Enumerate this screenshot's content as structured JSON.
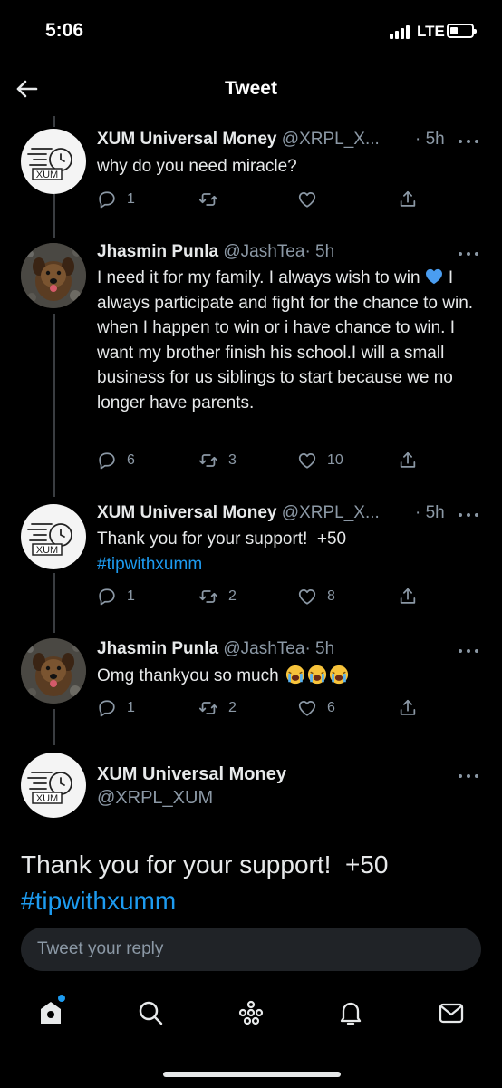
{
  "status": {
    "time": "5:06",
    "network": "LTE"
  },
  "header": {
    "title": "Tweet",
    "back_icon": "arrow-left-icon"
  },
  "tweets": [
    {
      "name": "XUM Universal Money",
      "handle": "@XRPL_X...",
      "time": "· 5h",
      "text": "why do you need miracle?",
      "counts": {
        "reply": "1",
        "retweet": "",
        "like": ""
      }
    },
    {
      "name": "Jhasmin Punla",
      "handle": "@JashTea",
      "time": "· 5h",
      "text_before_emoji": "I need it for my family. I always wish to win",
      "text_after_emoji": "I always participate and fight for the chance to win. when I happen to win or i have chance to win. I want my brother finish his school.I will a small business for us siblings to start because we no longer have parents.",
      "emoji": "blue-heart",
      "counts": {
        "reply": "6",
        "retweet": "3",
        "like": "10"
      }
    },
    {
      "name": "XUM Universal Money",
      "handle": "@XRPL_X...",
      "time": "· 5h",
      "text": "Thank you for your support!  +50",
      "hashtag": "#tipwithxumm",
      "counts": {
        "reply": "1",
        "retweet": "2",
        "like": "8"
      }
    },
    {
      "name": "Jhasmin Punla",
      "handle": "@JashTea",
      "time": "· 5h",
      "text": "Omg thankyou so much",
      "emoji": "loudly-crying-face",
      "counts": {
        "reply": "1",
        "retweet": "2",
        "like": "6"
      }
    }
  ],
  "main_tweet": {
    "name": "XUM Universal Money",
    "handle": "@XRPL_XUM",
    "text": "Thank you for your support!  +50",
    "hashtag": "#tipwithxumm"
  },
  "reply": {
    "placeholder": "Tweet your reply"
  },
  "nav": [
    "home-icon",
    "search-icon",
    "spaces-icon",
    "notifications-icon",
    "messages-icon"
  ],
  "colors": {
    "background": "#000000",
    "accent": "#1d9bf0",
    "muted": "#8b98a5",
    "text": "#e7e9ea"
  }
}
